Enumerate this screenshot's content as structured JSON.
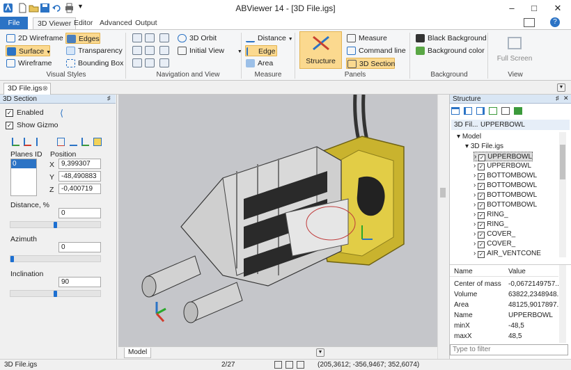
{
  "window": {
    "title": "ABViewer 14 - [3D File.igs]",
    "minimize": "–",
    "maximize": "□",
    "close": "✕"
  },
  "ribbon_tabs": [
    "File",
    "3D Viewer",
    "Editor",
    "Advanced",
    "Output"
  ],
  "ribbon": {
    "visual_styles": {
      "label": "Visual Styles",
      "wireframe2d": "2D Wireframe",
      "edges": "Edges",
      "surface": "Surface",
      "transparency": "Transparency",
      "wireframe": "Wireframe",
      "bounding_box": "Bounding Box"
    },
    "navigation": {
      "label": "Navigation and View",
      "orbit": "3D Orbit",
      "initial_view": "Initial View"
    },
    "measure": {
      "label": "Measure",
      "distance": "Distance",
      "edge": "Edge",
      "area": "Area"
    },
    "panels": {
      "label": "Panels",
      "structure": "Structure",
      "measure": "Measure",
      "command_line": "Command line",
      "section": "3D Section"
    },
    "background": {
      "label": "Background",
      "black": "Black Background",
      "color": "Background color"
    },
    "view": {
      "label": "View",
      "full_screen": "Full Screen"
    }
  },
  "doc_tab": {
    "label": "3D File.igs",
    "close": "⊗"
  },
  "section_panel": {
    "title": "3D Section",
    "enabled_label": "Enabled",
    "gizmo_label": "Show Gizmo",
    "planes_id_label": "Planes ID",
    "plane_ids": [
      "0"
    ],
    "position_label": "Position",
    "x_label": "X",
    "x": "9,399307",
    "y_label": "Y",
    "y": "-48,490883",
    "z_label": "Z",
    "z": "-0,400719",
    "distance_label": "Distance, %",
    "distance": "0",
    "distance_level": 0.5,
    "azimuth_label": "Azimuth",
    "azimuth": "0",
    "azimuth_level": 0.0,
    "inclination_label": "Inclination",
    "inclination": "90",
    "inclination_level": 0.5
  },
  "model_tab": "Model",
  "structure_panel": {
    "title": "Structure",
    "breadcrumb": [
      "3D Fil...",
      "UPPERBOWL"
    ],
    "tree_root": "Model",
    "tree_file": "3D File.igs",
    "tree_items": [
      "UPPERBOWL",
      "UPPERBOWL",
      "BOTTOMBOWL",
      "BOTTOMBOWL",
      "BOTTOMBOWL",
      "BOTTOMBOWL",
      "RING_",
      "RING_",
      "COVER_",
      "COVER_",
      "AIR_VENTCONE"
    ],
    "props_header": {
      "name": "Name",
      "value": "Value"
    },
    "props": [
      {
        "name": "Center of mass",
        "value": "-0,0672149757..."
      },
      {
        "name": "Volume",
        "value": "63822,2348948..."
      },
      {
        "name": "Area",
        "value": "48125,9017897..."
      },
      {
        "name": "Name",
        "value": "UPPERBOWL"
      },
      {
        "name": "minX",
        "value": "-48,5"
      },
      {
        "name": "maxX",
        "value": "48,5"
      }
    ],
    "filter_placeholder": "Type to filter"
  },
  "status": {
    "file": "3D File.igs",
    "page": "2/27",
    "coords": "(205,3612; -356,9467; 352,6074)"
  },
  "colors": {
    "file_tab": "#2b73c5",
    "highlight": "#fbd98f",
    "viewport": "#c5c6ca",
    "panel_head": "#d9e6f4"
  }
}
